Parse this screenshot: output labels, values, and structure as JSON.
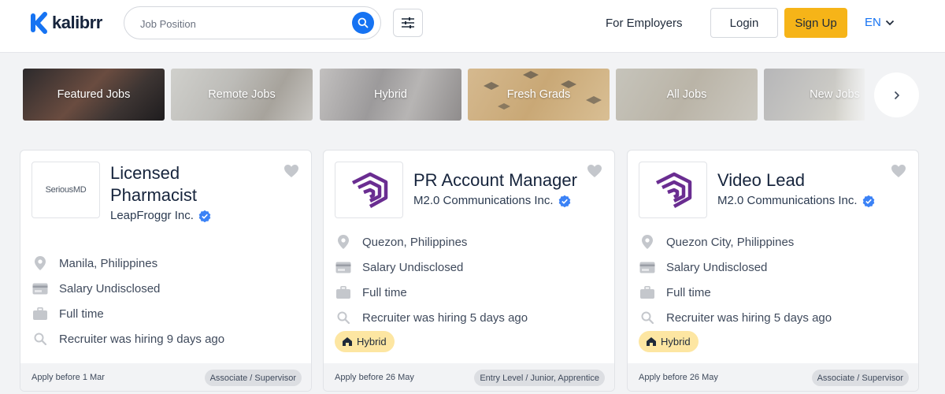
{
  "header": {
    "brand": "kalibrr",
    "search": {
      "placeholder": "Job Position",
      "value": ""
    },
    "for_employers": "For Employers",
    "login": "Login",
    "signup": "Sign Up",
    "language": "EN"
  },
  "categories": [
    {
      "label": "Featured Jobs"
    },
    {
      "label": "Remote Jobs"
    },
    {
      "label": "Hybrid"
    },
    {
      "label": "Fresh Grads"
    },
    {
      "label": "All Jobs"
    },
    {
      "label": "New Jobs"
    }
  ],
  "jobs": [
    {
      "logo_text": "SeriousMD",
      "title": "Licensed Pharmacist",
      "company": "LeapFroggr Inc.",
      "location": "Manila, Philippines",
      "salary": "Salary Undisclosed",
      "type": "Full time",
      "recruiter": "Recruiter was hiring 9 days ago",
      "apply_before": "Apply before 1 Mar",
      "level": "Associate / Supervisor"
    },
    {
      "title": "PR Account Manager",
      "company": "M2.0 Communications Inc.",
      "location": "Quezon, Philippines",
      "salary": "Salary Undisclosed",
      "type": "Full time",
      "recruiter": "Recruiter was hiring 5 days ago",
      "badge": "Hybrid",
      "apply_before": "Apply before 26 May",
      "level": "Entry Level / Junior, Apprentice"
    },
    {
      "title": "Video Lead",
      "company": "M2.0 Communications Inc.",
      "location": "Quezon City, Philippines",
      "salary": "Salary Undisclosed",
      "type": "Full time",
      "recruiter": "Recruiter was hiring 5 days ago",
      "badge": "Hybrid",
      "apply_before": "Apply before 26 May",
      "level": "Associate / Supervisor"
    }
  ],
  "colors": {
    "accent": "#1673f2",
    "signup": "#f6b418",
    "badge": "#fde6a2",
    "m20_logo": "#6a2d91",
    "verified": "#3b82f6"
  },
  "icons": [
    "kalibrr-logo-icon",
    "search-icon",
    "filter-sliders-icon",
    "chevron-down-icon",
    "chevron-right-icon",
    "heart-icon",
    "verified-icon",
    "location-pin-icon",
    "credit-card-icon",
    "briefcase-icon",
    "magnifier-icon",
    "house-icon"
  ]
}
